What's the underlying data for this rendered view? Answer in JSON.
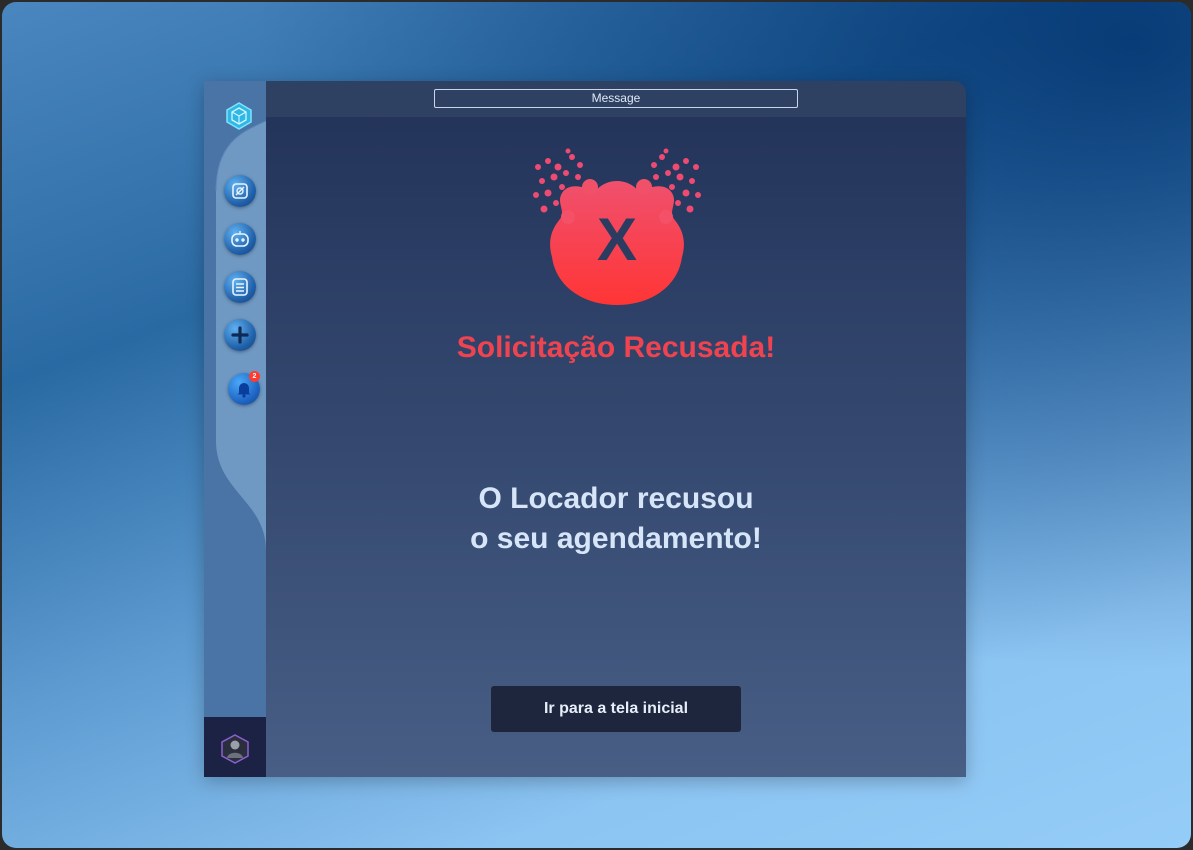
{
  "window": {
    "title": "Message"
  },
  "sidebar": {
    "items": [
      {
        "icon": "logo-icon"
      },
      {
        "icon": "dashboard-icon"
      },
      {
        "icon": "robot-icon"
      },
      {
        "icon": "checklist-icon"
      },
      {
        "icon": "add-icon"
      },
      {
        "icon": "notification-bell-icon",
        "badge": "2"
      }
    ],
    "avatar": "user-avatar"
  },
  "dialog": {
    "hero_icon": "rejected-x-splash-icon",
    "hero_letter": "X",
    "heading": "Solicitação Recusada!",
    "message_line1": "O Locador recusou",
    "message_line2": "o seu agendamento!",
    "button_label": "Ir para a tela inicial"
  },
  "colors": {
    "accent_red": "#ef4450",
    "panel_dark": "#223258",
    "button_bg": "#1d263c",
    "sidebar": "#6f98c2"
  }
}
